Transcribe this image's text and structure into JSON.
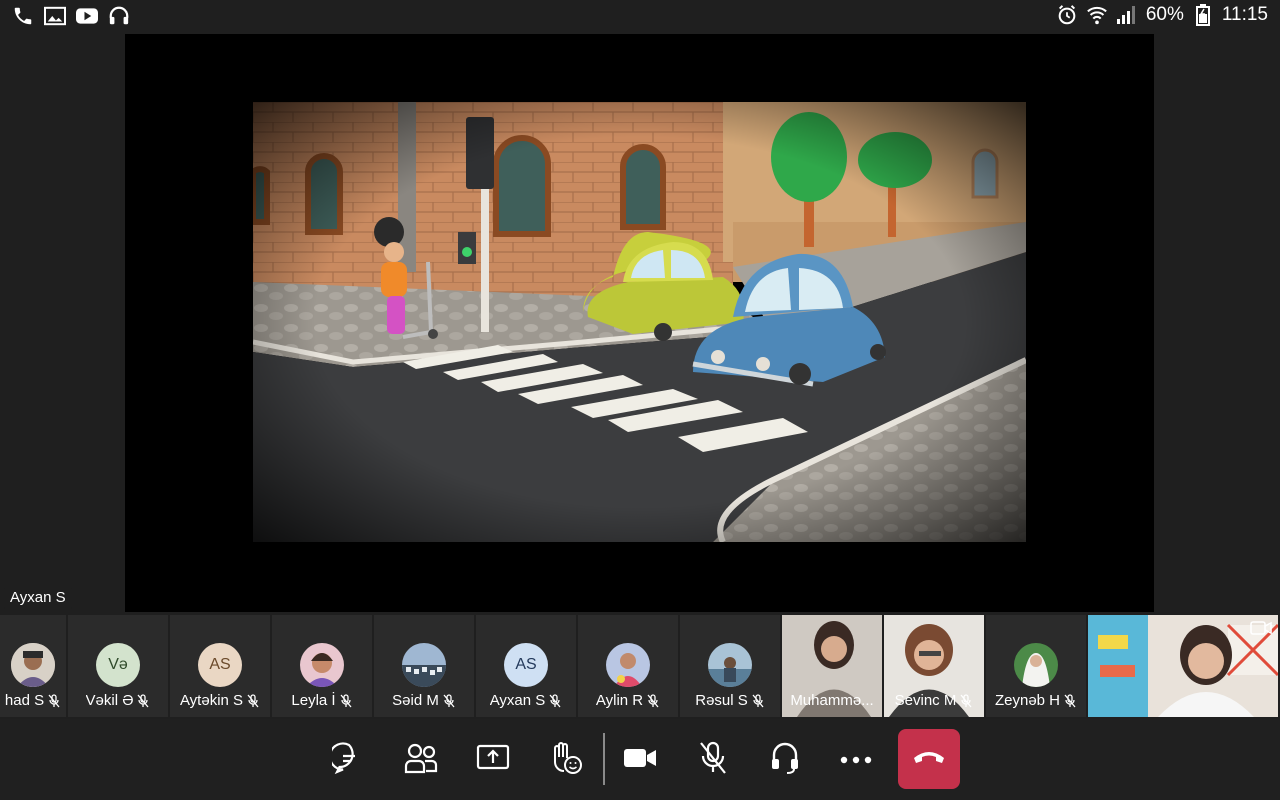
{
  "status_bar": {
    "battery": "60%",
    "time": "11:15",
    "left_icons": [
      "phone-icon",
      "gallery-icon",
      "youtube-icon",
      "headphones-icon"
    ],
    "right_icons": [
      "alarm-icon",
      "wifi-icon",
      "signal-icon",
      "battery-icon"
    ]
  },
  "presenter": {
    "name": "Ayxan S"
  },
  "participants": [
    {
      "name": "had S",
      "type": "photo",
      "muted": true
    },
    {
      "name": "Vəkil Ə",
      "type": "initials",
      "initials": "Və",
      "bg": "#d3e3cd",
      "fg": "#2f4a2a",
      "muted": true
    },
    {
      "name": "Aytəkin S",
      "type": "initials",
      "initials": "AS",
      "bg": "#ead7c4",
      "fg": "#6b4a2b",
      "muted": true
    },
    {
      "name": "Leyla İ",
      "type": "photo",
      "muted": true
    },
    {
      "name": "Səid M",
      "type": "photo",
      "muted": true
    },
    {
      "name": "Ayxan S",
      "type": "initials",
      "initials": "AS",
      "bg": "#cfe0f3",
      "fg": "#243a5c",
      "muted": true
    },
    {
      "name": "Aylin R",
      "type": "photo",
      "muted": true
    },
    {
      "name": "Rəsul S",
      "type": "photo",
      "muted": true
    },
    {
      "name": "Muhammə...",
      "type": "video",
      "muted": false
    },
    {
      "name": "Sevinc M",
      "type": "video",
      "muted": true
    },
    {
      "name": "Zeynəb H",
      "type": "photo",
      "muted": true
    }
  ],
  "toolbar": {
    "buttons": [
      "chat-icon",
      "participants-icon",
      "share-icon",
      "raise-hand-icon",
      "camera-icon",
      "mic-off-icon",
      "audio-icon",
      "more-icon"
    ],
    "hangup_color": "#c4314b"
  }
}
